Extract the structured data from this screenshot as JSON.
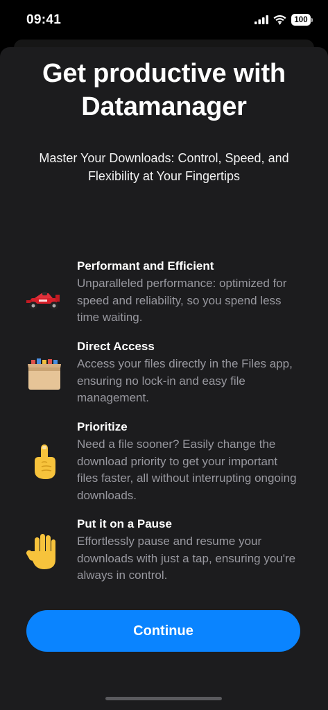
{
  "status_bar": {
    "time": "09:41",
    "battery": "100",
    "icons": [
      "signal-icon",
      "wifi-icon",
      "battery-icon"
    ]
  },
  "sheet": {
    "title": "Get productive with Datamanager",
    "subtitle": "Master Your Downloads: Control, Speed, and Flexibility at Your Fingertips",
    "features": [
      {
        "icon": "race-car-icon",
        "title": "Performant and Efficient",
        "description": "Unparalleled performance: optimized for speed and reliability, so you spend less time waiting."
      },
      {
        "icon": "file-cabinet-icon",
        "title": "Direct Access",
        "description": "Access your files directly in the Files app, ensuring no lock-in and easy file management."
      },
      {
        "icon": "pointing-finger-icon",
        "title": "Prioritize",
        "description": "Need a file sooner? Easily change the download priority to get your important files faster, all without interrupting ongoing downloads."
      },
      {
        "icon": "raised-hand-icon",
        "title": "Put it on a Pause",
        "description": "Effortlessly pause and resume your downloads with just a tap, ensuring you're always in control."
      }
    ],
    "continue_label": "Continue"
  },
  "colors": {
    "background": "#000000",
    "sheet": "#1c1c1e",
    "accent": "#0a84ff",
    "secondary_text": "#98989f"
  }
}
